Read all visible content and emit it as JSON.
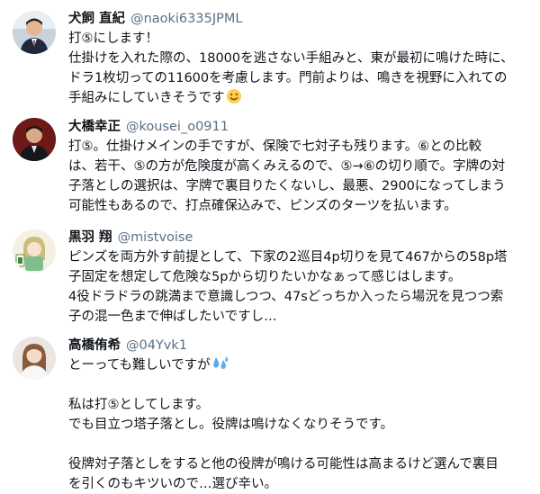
{
  "posts": [
    {
      "name": "犬飼 直紀",
      "handle": "@naoki6335JPML",
      "lines": [
        "打⑤にします！",
        "仕掛けを入れた際の、18000を逃さない手組みと、東が最初に鳴けた時に、",
        "ドラ1枚切っての11600を考慮します。門前よりは、鳴きを視野に入れての",
        "手組みにしていきそうです"
      ],
      "emoji": "smiling-face-emoji"
    },
    {
      "name": "大橋幸正",
      "handle": "@kousei_o0911",
      "lines": [
        "打⑤。仕掛けメインの手ですが、保険で七対子も残ります。⑥との比較",
        "は、若干、⑤の方が危険度が高くみえるので、⑤→⑥の切り順で。字牌の対",
        "子落としの選択は、字牌で裏目りたくないし、最悪、2900になってしまう",
        "可能性もあるので、打点確保込みで、ピンズのターツを払います。"
      ]
    },
    {
      "name": "黒羽 翔",
      "handle": "@mistvoise",
      "lines": [
        "ピンズを両方外す前提として、下家の2巡目4p切りを見て467からの58p塔",
        "子固定を想定して危険な5pから切りたいかなぁって感じはします。",
        "4役ドラドラの跳満まで意識しつつ、47sどっちか入ったら場況を見つつ索",
        "子の混一色まで伸ばしたいですし…"
      ]
    },
    {
      "name": "高橋侑希",
      "handle": "@04Yvk1",
      "line_first": "とーっても難しいですが",
      "emoji": "sweat-droplets-emoji",
      "lines": [
        "私は打⑤としてします。",
        "でも目立つ塔子落とし。役牌は鳴けなくなりそうです。",
        "",
        "役牌対子落としをすると他の役牌が鳴ける可能性は高まるけど選んで裏目",
        "を引くのもキツいので…選び辛い。"
      ]
    }
  ]
}
